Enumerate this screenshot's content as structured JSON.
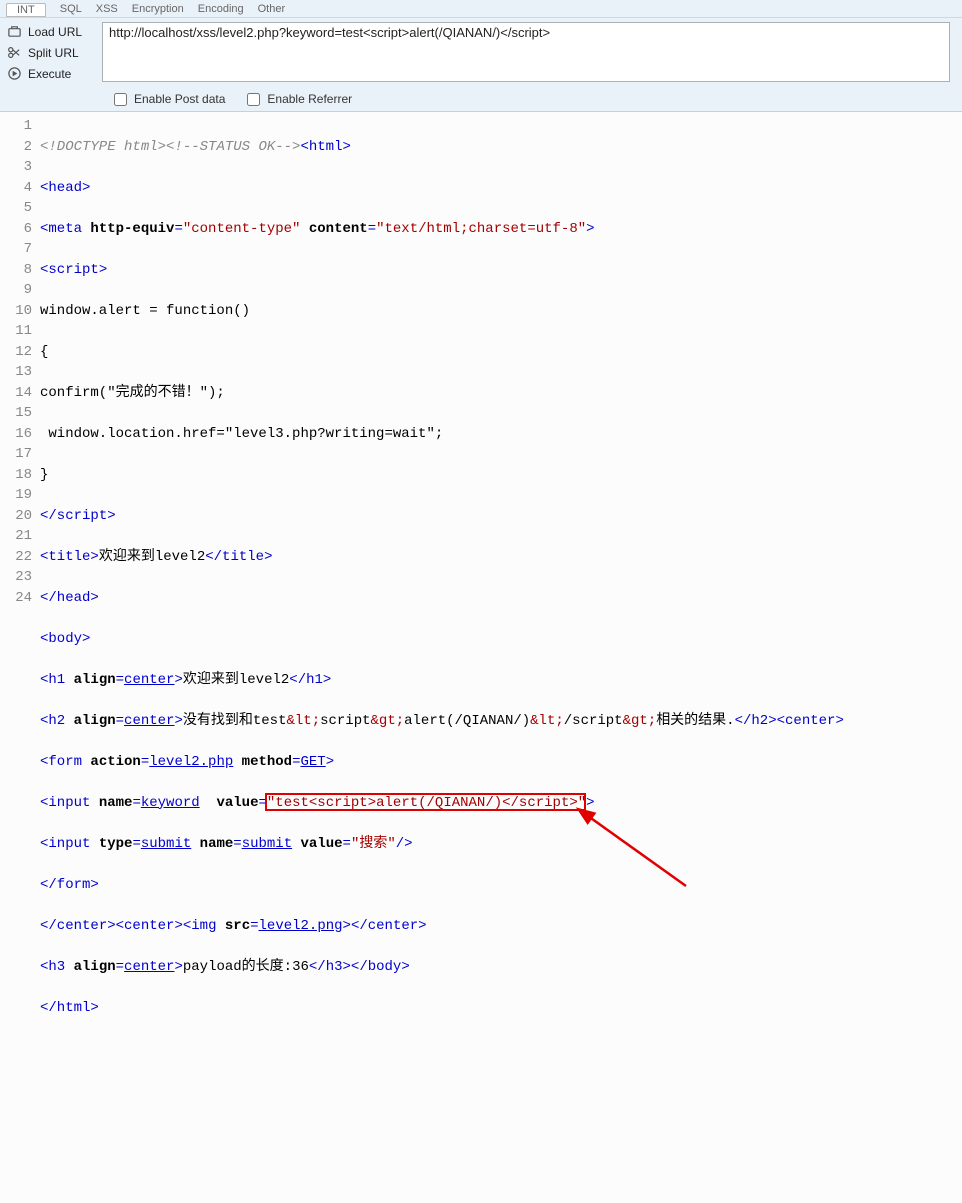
{
  "topTabs": {
    "int": "INT",
    "items": [
      "SQL",
      "XSS",
      "Encryption",
      "Encoding",
      "Other"
    ]
  },
  "side": {
    "load": "Load URL",
    "split": "Split URL",
    "execute": "Execute"
  },
  "url": "http://localhost/xss/level2.php?keyword=test<script>alert(/QIANAN/)</script>",
  "options": {
    "post": "Enable Post data",
    "referrer": "Enable Referrer"
  },
  "code": {
    "l1_a": "<!DOCTYPE html>",
    "l1_b": "<!--STATUS OK-->",
    "l1_c": "html",
    "l2": "head",
    "l3_tag": "meta",
    "l3_a1": "http-equiv",
    "l3_v1": "\"content-type\"",
    "l3_a2": "content",
    "l3_v2": "\"text/html;charset=utf-8\"",
    "l4": "script",
    "l5": "window.alert = function()",
    "l6": "{",
    "l7": "confirm(\"完成的不错！\");",
    "l8": " window.location.href=\"level3.php?writing=wait\"; ",
    "l9": "}",
    "l10": "/script",
    "l11_a": "title",
    "l11_b": "欢迎来到level2",
    "l11_c": "/title",
    "l12": "/head",
    "l13": "body",
    "l14_a": "h1",
    "l14_b": "align",
    "l14_c": "center",
    "l14_d": "欢迎来到level2",
    "l14_e": "/h1",
    "l15_a": "h2",
    "l15_b": "align",
    "l15_c": "center",
    "l15_d1": "没有找到和test",
    "l15_e1": "&lt;",
    "l15_d2": "script",
    "l15_e2": "&gt;",
    "l15_d3": "alert(/QIANAN/)",
    "l15_e3": "&lt;",
    "l15_d4": "/script",
    "l15_e4": "&gt;",
    "l15_d5": "相关的结果.",
    "l15_f": "/h2",
    "l15_g": "center",
    "l16_a": "form",
    "l16_b": "action",
    "l16_c": "level2.php",
    "l16_d": "method",
    "l16_e": "GET",
    "l17_a": "input",
    "l17_b": "name",
    "l17_c": "keyword",
    "l17_d": "value",
    "l17_e": "\"test<script>alert(/QIANAN/)</script>\"",
    "l18_a": "input",
    "l18_b": "type",
    "l18_c": "submit",
    "l18_d": "name",
    "l18_e": "submit",
    "l18_f": "value",
    "l18_g": "\"搜索\"",
    "l19": "/form",
    "l20_a": "/center",
    "l20_b": "center",
    "l20_c": "img",
    "l20_d": "src",
    "l20_e": "level2.png",
    "l20_f": "/center",
    "l21_a": "h3",
    "l21_b": "align",
    "l21_c": "center",
    "l21_d": "payload的长度:36",
    "l21_e": "/h3",
    "l21_f": "/body",
    "l22": "/html"
  },
  "lineCount": 24
}
